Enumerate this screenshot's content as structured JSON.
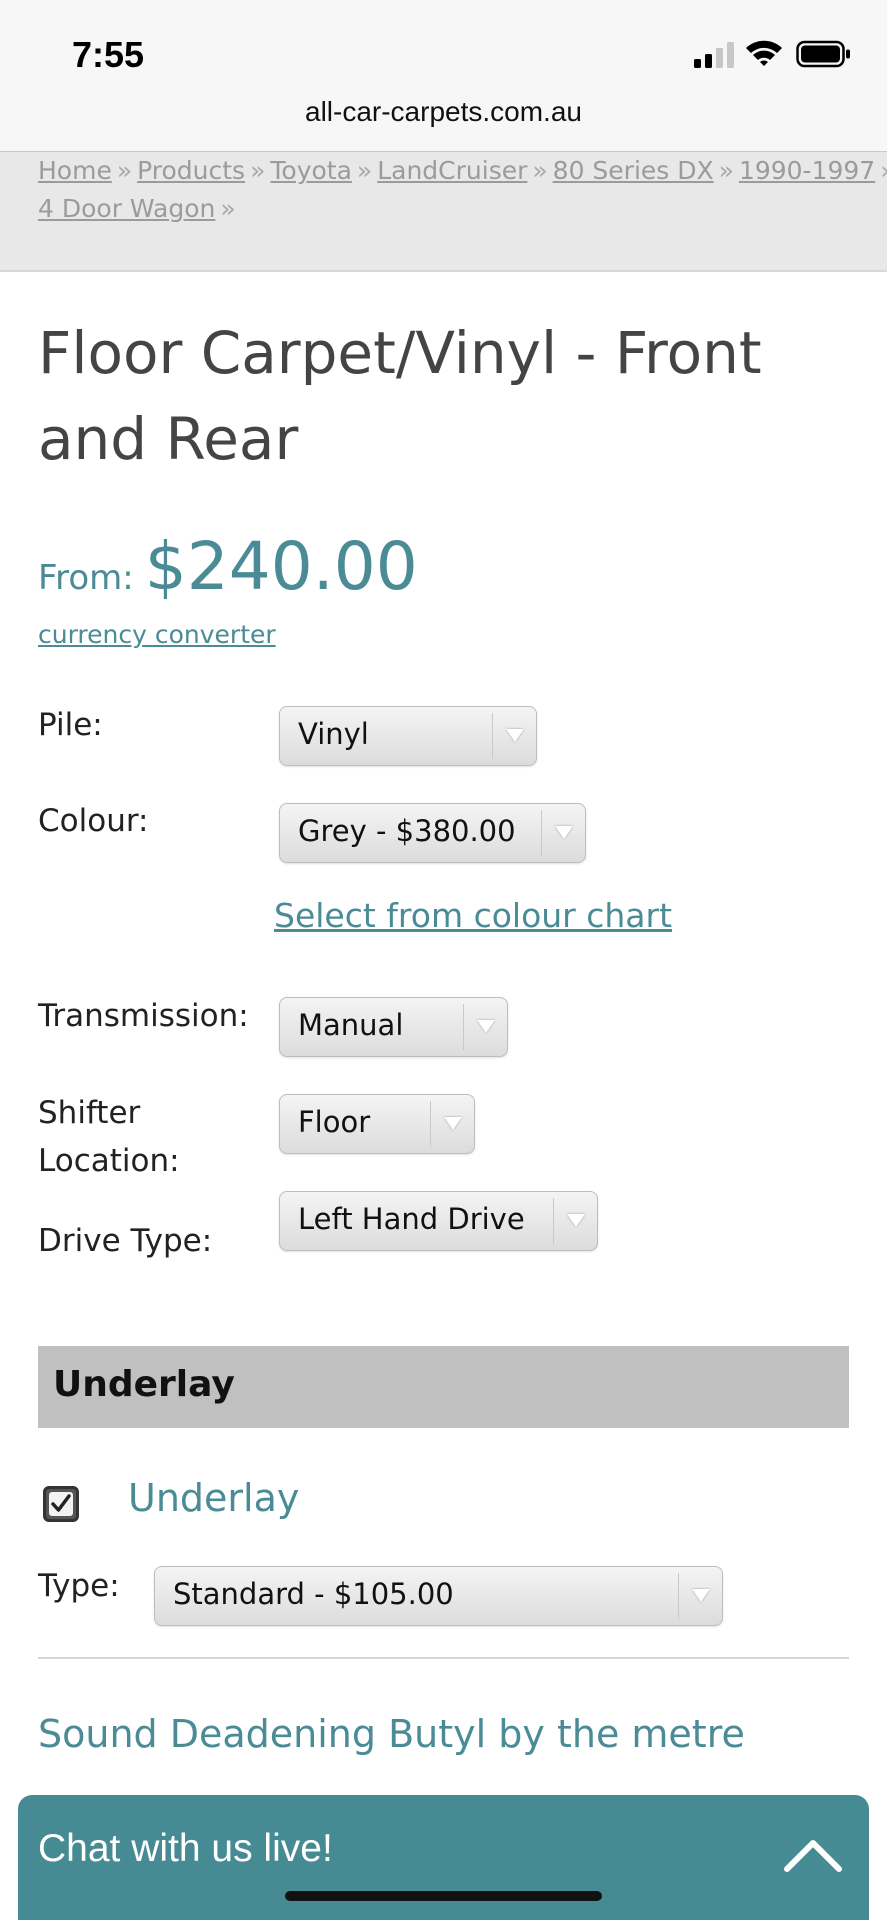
{
  "status_bar": {
    "time": "7:55",
    "signal_icon": "cellular-signal-icon",
    "wifi_icon": "wifi-icon",
    "battery_icon": "battery-icon"
  },
  "url_bar": {
    "url": "all-car-carpets.com.au"
  },
  "breadcrumb": {
    "items": [
      "Home",
      "Products",
      "Toyota",
      "LandCruiser",
      "80 Series DX",
      "1990-1997",
      "4 Door Wagon"
    ],
    "separator": "»"
  },
  "product": {
    "title": "Floor Carpet/Vinyl - Front and Rear",
    "price_label": "From:",
    "price": "$240.00",
    "currency_link": "currency converter"
  },
  "options": {
    "pile": {
      "label": "Pile:",
      "value": "Vinyl"
    },
    "colour": {
      "label": "Colour:",
      "value": "Grey - $380.00"
    },
    "colour_chart_link": "Select from colour chart",
    "transmission": {
      "label": "Transmission:",
      "value": "Manual"
    },
    "shifter": {
      "label_line1": "Shifter",
      "label_line2": "Location:",
      "value": "Floor"
    },
    "drive_type": {
      "label": "Drive Type:",
      "value": "Left Hand Drive"
    }
  },
  "underlay": {
    "section_title": "Underlay",
    "checkbox_checked": true,
    "checkbox_label": "Underlay",
    "type_label": "Type:",
    "type_value": "Standard - $105.00"
  },
  "sound_deadening": {
    "label": "Sound Deadening Butyl by the metre"
  },
  "chat": {
    "label": "Chat with us live!",
    "icon": "chevron-up-icon"
  },
  "colors": {
    "accent": "#4a8b96",
    "chat_background": "#468b94",
    "section_header": "#c0c0c0",
    "breadcrumb_background": "#e8e8e8"
  }
}
